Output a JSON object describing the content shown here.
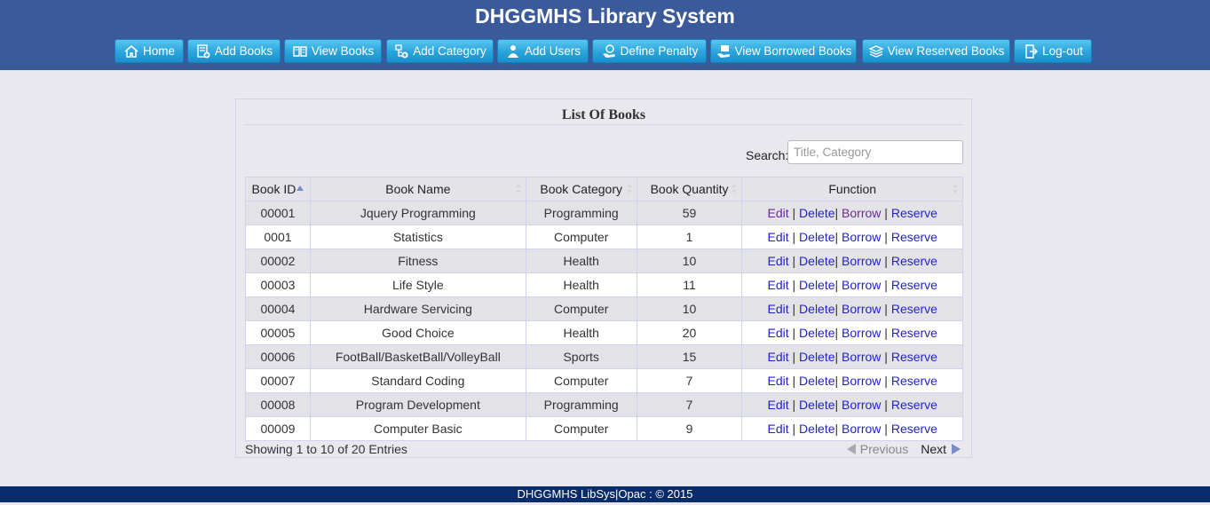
{
  "app": {
    "title": "DHGGMHS Library System"
  },
  "nav": [
    {
      "label": "Home",
      "icon": "home-icon"
    },
    {
      "label": "Add Books",
      "icon": "add-book-icon"
    },
    {
      "label": "View Books",
      "icon": "view-books-icon"
    },
    {
      "label": "Add Category",
      "icon": "add-category-icon"
    },
    {
      "label": "Add Users",
      "icon": "add-user-icon"
    },
    {
      "label": "Define Penalty",
      "icon": "penalty-icon"
    },
    {
      "label": "View Borrowed Books",
      "icon": "borrowed-books-icon"
    },
    {
      "label": "View Reserved Books",
      "icon": "reserved-books-icon"
    },
    {
      "label": "Log-out",
      "icon": "logout-icon"
    }
  ],
  "panel": {
    "title": "List Of Books",
    "search_label": "Search:",
    "search_placeholder": "Title, Category",
    "search_value": ""
  },
  "table": {
    "columns": [
      "Book ID",
      "Book Name",
      "Book Category",
      "Book Quantity",
      "Function"
    ],
    "sorted_column": "Book ID",
    "rows": [
      {
        "id": "00001",
        "name": "Jquery Programming",
        "category": "Programming",
        "quantity": "59"
      },
      {
        "id": "0001",
        "name": "Statistics",
        "category": "Computer",
        "quantity": "1"
      },
      {
        "id": "00002",
        "name": "Fitness",
        "category": "Health",
        "quantity": "10"
      },
      {
        "id": "00003",
        "name": "Life Style",
        "category": "Health",
        "quantity": "11"
      },
      {
        "id": "00004",
        "name": "Hardware Servicing",
        "category": "Computer",
        "quantity": "10"
      },
      {
        "id": "00005",
        "name": "Good Choice",
        "category": "Health",
        "quantity": "20"
      },
      {
        "id": "00006",
        "name": "FootBall/BasketBall/VolleyBall",
        "category": "Sports",
        "quantity": "15"
      },
      {
        "id": "00007",
        "name": "Standard Coding",
        "category": "Computer",
        "quantity": "7"
      },
      {
        "id": "00008",
        "name": "Program Development",
        "category": "Programming",
        "quantity": "7"
      },
      {
        "id": "00009",
        "name": "Computer Basic",
        "category": "Computer",
        "quantity": "9"
      }
    ],
    "actions": {
      "edit": "Edit",
      "delete": "Delete",
      "borrow": "Borrow",
      "reserve": "Reserve",
      "sep": "|"
    }
  },
  "pagination": {
    "info": "Showing 1 to 10 of 20 Entries",
    "previous": "Previous",
    "next": "Next"
  },
  "footer": {
    "text": "DHGGMHS LibSys|Opac : © 2015"
  },
  "colors": {
    "header": "#3b5a9a",
    "button": "#2aa4dc",
    "footer": "#0b2c6a",
    "link": "#2222cc",
    "visited_link": "#6b2a9a"
  }
}
